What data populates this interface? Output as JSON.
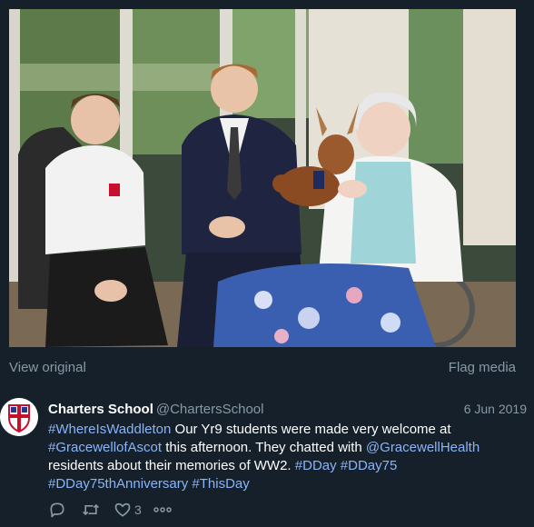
{
  "media": {
    "view_original": "View original",
    "flag_media": "Flag media"
  },
  "tweet": {
    "author_name": "Charters School",
    "author_handle": "@ChartersSchool",
    "date": "6 Jun 2019",
    "lines": [
      [
        {
          "t": "#WhereIsWaddleton",
          "k": "hash"
        },
        {
          "t": " Our Yr9 students were made very welcome at",
          "k": "text"
        }
      ],
      [
        {
          "t": "#GracewellofAscot",
          "k": "hash"
        },
        {
          "t": " this afternoon. They chatted with ",
          "k": "text"
        },
        {
          "t": "@GracewellHealth",
          "k": "mention"
        }
      ],
      [
        {
          "t": "residents about their memories of WW2. ",
          "k": "text"
        },
        {
          "t": "#DDay",
          "k": "hash"
        },
        {
          "t": " ",
          "k": "text"
        },
        {
          "t": "#DDay75",
          "k": "hash"
        }
      ],
      [
        {
          "t": "#DDay75thAnniversary",
          "k": "hash"
        },
        {
          "t": " ",
          "k": "text"
        },
        {
          "t": "#ThisDay",
          "k": "hash"
        }
      ]
    ],
    "like_count": "3"
  },
  "icons": {
    "reply": "reply-icon",
    "retweet": "retweet-icon",
    "like": "heart-icon",
    "more": "more-icon"
  },
  "colors": {
    "background": "#15202b",
    "secondary_text": "#8899a6",
    "link": "#8ab4f8",
    "school_red": "#c8102e"
  }
}
